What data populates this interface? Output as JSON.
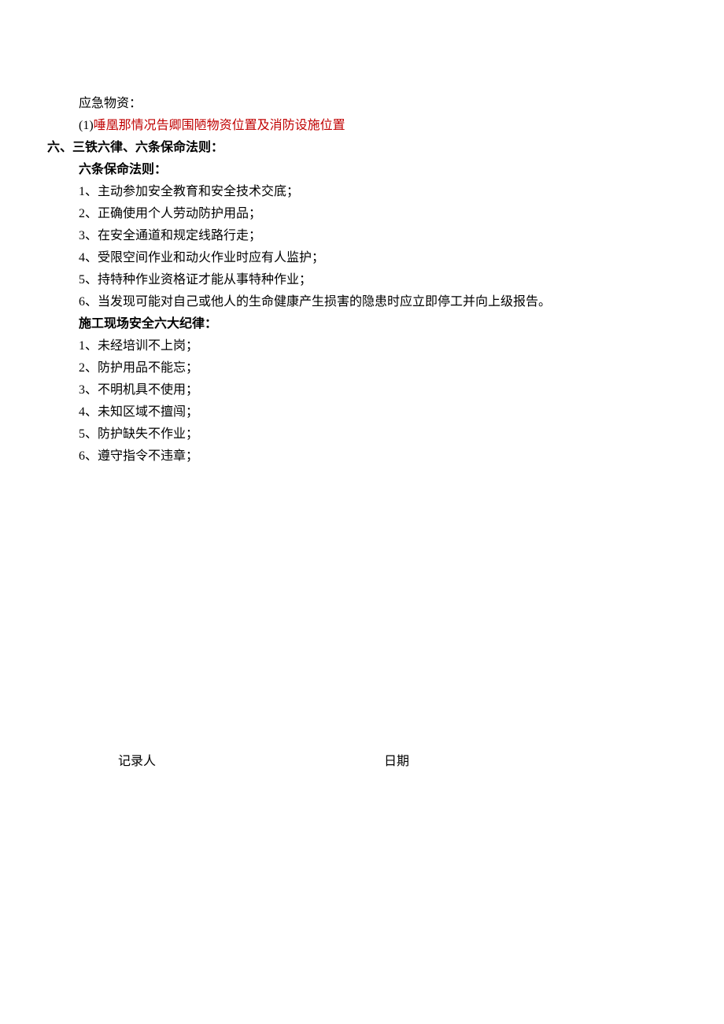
{
  "top": {
    "materials_label": "应急物资：",
    "annotated_prefix": "(1)",
    "annotated_text": "唾凰那情况告卿围陋物资位置及消防设施位置"
  },
  "section6": {
    "heading": "六、三铁六律、六条保命法则：",
    "rules_heading": "六条保命法则：",
    "rules": [
      "1、主动参加安全教育和安全技术交底；",
      "2、正确使用个人劳动防护用品；",
      "3、在安全通道和规定线路行走；",
      "4、受限空间作业和动火作业时应有人监护；",
      "5、持特种作业资格证才能从事特种作业；",
      "6、当发现可能对自己或他人的生命健康产生损害的隐患时应立即停工并向上级报告。"
    ],
    "disciplines_heading": "施工现场安全六大纪律：",
    "disciplines": [
      "1、未经培训不上岗；",
      "2、防护用品不能忘；",
      "3、不明机具不使用；",
      "4、未知区域不擅闯；",
      "5、防护缺失不作业；",
      "6、遵守指令不违章；"
    ]
  },
  "signature": {
    "recorder_label": "记录人",
    "date_label": "日期"
  }
}
